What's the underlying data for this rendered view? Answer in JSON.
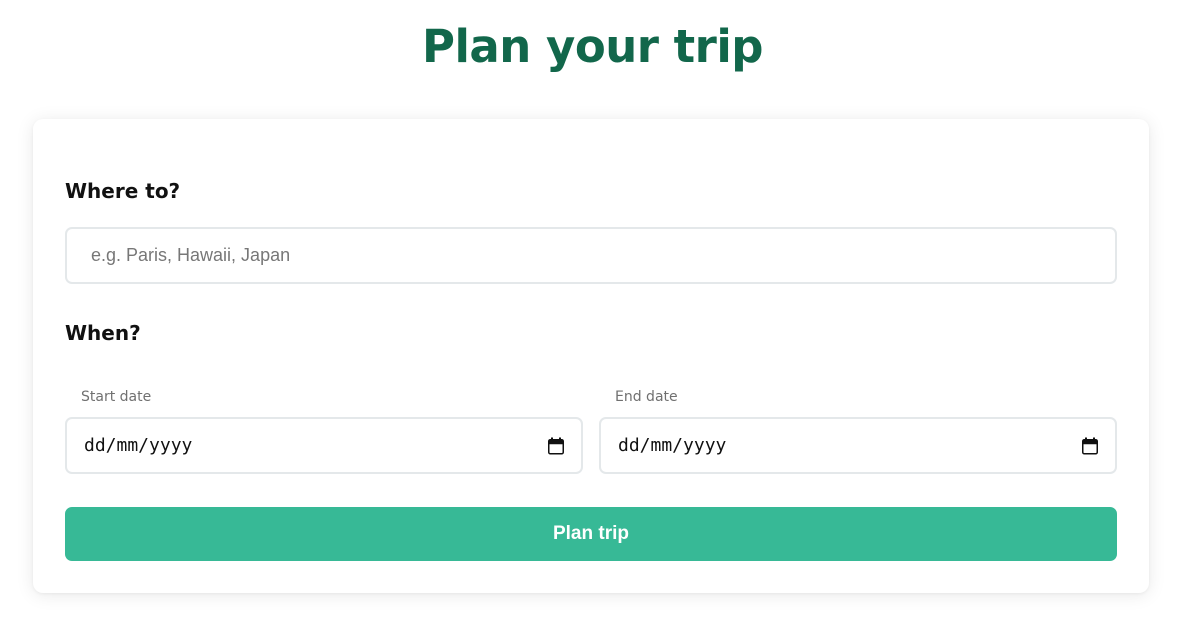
{
  "page": {
    "title": "Plan your trip"
  },
  "form": {
    "destination": {
      "label": "Where to?",
      "placeholder": "e.g. Paris, Hawaii, Japan",
      "value": ""
    },
    "dates": {
      "label": "When?",
      "start": {
        "caption": "Start date",
        "display": "dd/mm/yyyy",
        "icon": "calendar-icon"
      },
      "end": {
        "caption": "End date",
        "display": "dd/mm/yyyy",
        "icon": "calendar-icon"
      }
    },
    "submit_label": "Plan trip"
  },
  "colors": {
    "title": "#12674b",
    "button": "#37b996",
    "border": "#e4e8ea"
  }
}
